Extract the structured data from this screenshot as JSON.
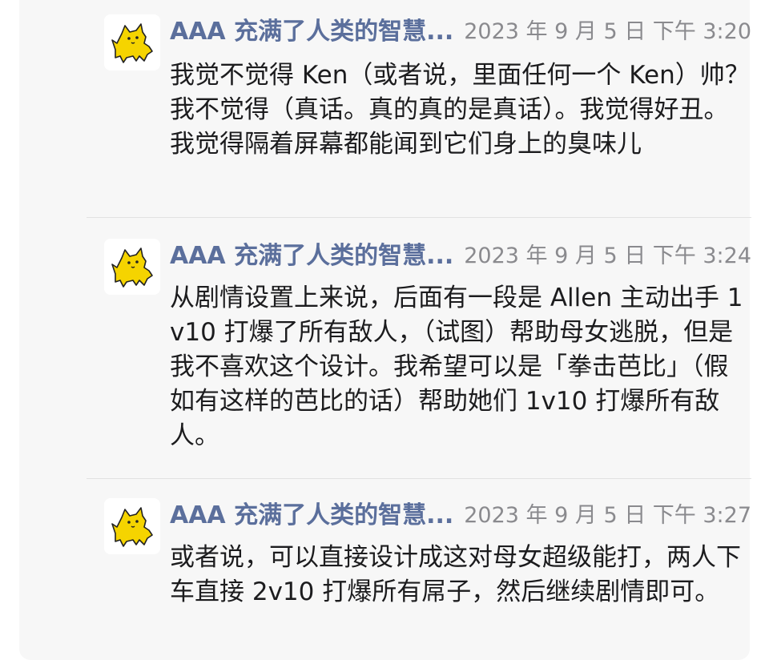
{
  "messages": [
    {
      "avatar_icon": "yellow-cat-icon",
      "sender": "AAA 充满了人类的智慧...",
      "time": "2023 年 9 月 5 日 下午 3:20",
      "text": "我觉不觉得 Ken（或者说，里面任何一个 Ken）帅？我不觉得（真话。真的真的是真话）。我觉得好丑。我觉得隔着屏幕都能闻到它们身上的臭味儿"
    },
    {
      "avatar_icon": "yellow-cat-icon",
      "sender": "AAA 充满了人类的智慧...",
      "time": "2023 年 9 月 5 日 下午 3:24",
      "text": "从剧情设置上来说，后面有一段是 Allen 主动出手 1v10 打爆了所有敌人，（试图）帮助母女逃脱，但是我不喜欢这个设计。我希望可以是「拳击芭比」（假如有这样的芭比的话）帮助她们 1v10 打爆所有敌人。"
    },
    {
      "avatar_icon": "yellow-cat-icon",
      "sender": "AAA 充满了人类的智慧...",
      "time": "2023 年 9 月 5 日 下午 3:27",
      "text": "或者说，可以直接设计成这对母女超级能打，两人下车直接 2v10 打爆所有屌子，然后继续剧情即可。"
    }
  ],
  "colors": {
    "sender_name": "#5b6f9c",
    "timestamp": "#8a8a8e",
    "body_text": "#1c1c1e",
    "background": "#f7f7f7",
    "avatar_cat": "#f5d400"
  }
}
